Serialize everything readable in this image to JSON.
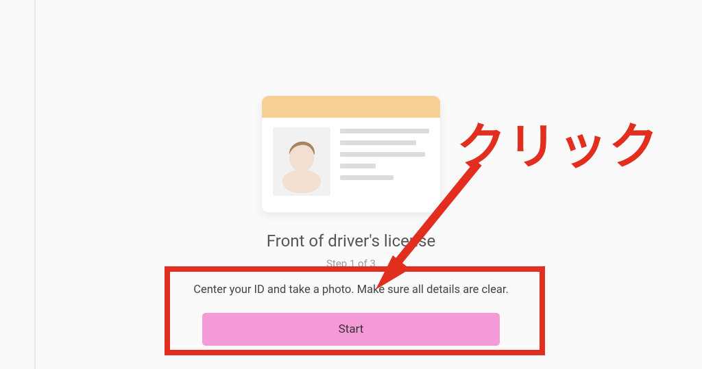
{
  "title": "Front of driver's license",
  "step_text": "Step 1 of 3",
  "instruction": "Center your ID and take a photo. Make sure all details are clear.",
  "start_label": "Start",
  "annotation": {
    "callout": "クリック"
  }
}
